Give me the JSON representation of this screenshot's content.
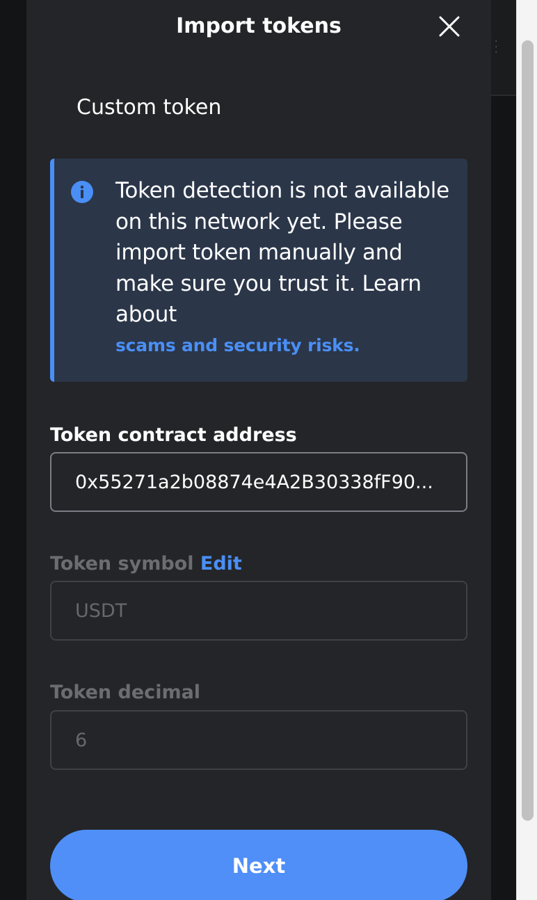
{
  "modal": {
    "title": "Import tokens",
    "tab_label": "Custom token"
  },
  "banner": {
    "message": "Token detection is not available on this network yet. Please import token manually and make sure you trust it. Learn about",
    "link_text": "scams and security risks."
  },
  "fields": {
    "contract_address": {
      "label": "Token contract address",
      "value": "0x55271a2b08874e4A2B30338fF90..."
    },
    "symbol": {
      "label": "Token symbol",
      "edit_label": "Edit",
      "value": "USDT"
    },
    "decimal": {
      "label": "Token decimal",
      "value": "6"
    }
  },
  "actions": {
    "next_label": "Next"
  },
  "colors": {
    "accent": "#4a8ff5",
    "modal_background": "#242528",
    "banner_background": "#2b3649"
  }
}
